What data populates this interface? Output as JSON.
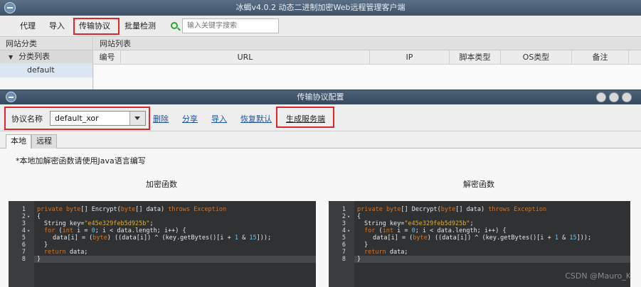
{
  "main_window": {
    "title": "冰蝎v4.0.2 动态二进制加密Web远程管理客户端"
  },
  "toolbar": {
    "proxy_label": "代理",
    "import_label": "导入",
    "transport_label": "传输协议",
    "batch_label": "批量检测",
    "search_placeholder": "输入关键字搜索"
  },
  "left_panel": {
    "header": "网站分类",
    "group_label": "分类列表",
    "items": [
      "default"
    ]
  },
  "right_panel": {
    "header": "网站列表",
    "columns": [
      "编号",
      "URL",
      "IP",
      "脚本类型",
      "OS类型",
      "备注"
    ]
  },
  "dialog": {
    "title": "传输协议配置",
    "protocol_label": "协议名称",
    "protocol_value": "default_xor",
    "delete_label": "删除",
    "share_label": "分享",
    "import_label": "导入",
    "reset_label": "恢复默认",
    "generate_label": "生成服务端",
    "tabs": [
      "本地",
      "远程"
    ],
    "note": "*本地加解密函数请使用Java语言编写",
    "encrypt_header": "加密函数",
    "decrypt_header": "解密函数"
  },
  "editors": {
    "line_numbers": [
      "1",
      "2",
      "3",
      "4",
      "5",
      "6",
      "7",
      "8"
    ],
    "encrypt": {
      "sig_type": "private byte",
      "sig_name": "[] Encrypt(",
      "sig_type2": "byte",
      "sig_rest": "[] data) ",
      "sig_throws": "throws Exception",
      "l2": "{",
      "l3_type": "String ",
      "l3_var": "key=",
      "l3_str": "\"e45e329feb5d925b\"",
      "l3_end": ";",
      "l4_kw": "for",
      "l4_a": " (",
      "l4_int": "int",
      "l4_b": " i = ",
      "l4_zero": "0",
      "l4_c": "; i < data.length; i++) {",
      "l5_a": "data[i] = (",
      "l5_byte": "byte",
      "l5_b": ") ((data[i]) ^ (key.getBytes()[i + ",
      "l5_num1": "1",
      "l5_c": " & ",
      "l5_num2": "15",
      "l5_d": "]));",
      "l6": "}",
      "l7_kw": "return",
      "l7_rest": " data;",
      "l8": "}"
    },
    "decrypt": {
      "sig_name": "[] Decrypt("
    }
  },
  "watermark": "CSDN @Mauro_K"
}
